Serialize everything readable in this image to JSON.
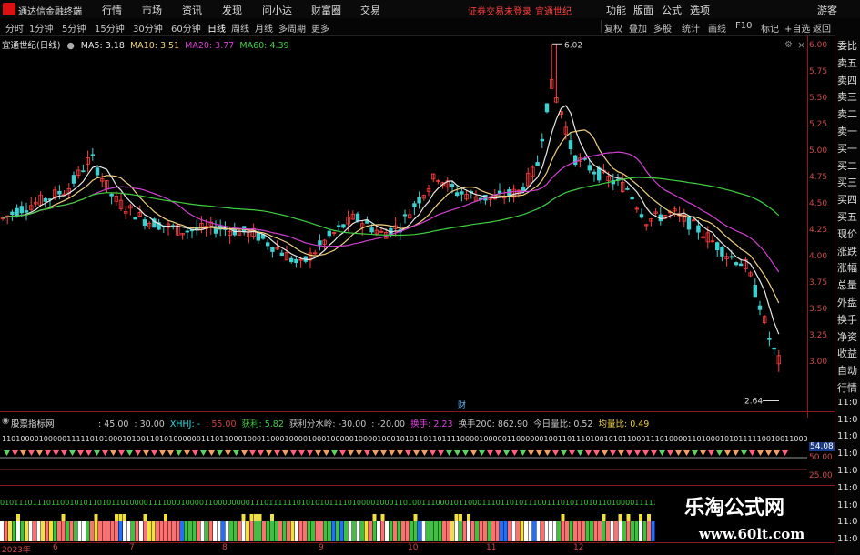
{
  "app": {
    "title": "通达信金融终端",
    "login_tip": "证券交易未登录",
    "stock_name": "宜通世纪"
  },
  "menu": [
    "行情",
    "市场",
    "资讯",
    "发现",
    "问小达",
    "财富圈",
    "交易"
  ],
  "top_right": [
    "功能",
    "版面",
    "公式",
    "选项",
    "游客"
  ],
  "periods": [
    {
      "label": "分时",
      "active": false
    },
    {
      "label": "1分钟",
      "active": false
    },
    {
      "label": "5分钟",
      "active": false
    },
    {
      "label": "15分钟",
      "active": false
    },
    {
      "label": "30分钟",
      "active": false
    },
    {
      "label": "60分钟",
      "active": false
    },
    {
      "label": "日线",
      "active": true
    },
    {
      "label": "周线",
      "active": false
    },
    {
      "label": "月线",
      "active": false
    },
    {
      "label": "多周期",
      "active": false
    },
    {
      "label": "更多",
      "active": false
    }
  ],
  "toolbar_right": [
    "复权",
    "叠加",
    "多股",
    "统计",
    "画线",
    "F10",
    "标记",
    "+自选",
    "返回"
  ],
  "chart": {
    "title": "宜通世纪(日线)",
    "ma": [
      {
        "label": "MA5: 3.18",
        "color": "#e8e8e8"
      },
      {
        "label": "MA10: 3.51",
        "color": "#f0d080"
      },
      {
        "label": "MA20: 3.77",
        "color": "#d040d0"
      },
      {
        "label": "MA60: 4.39",
        "color": "#40d040"
      }
    ],
    "high_label": "6.02",
    "low_label": "2.64",
    "y_ticks": [
      "6.00",
      "5.75",
      "5.50",
      "5.25",
      "5.00",
      "4.75",
      "4.50",
      "4.25",
      "4.00",
      "3.75",
      "3.50",
      "3.25",
      "3.00"
    ],
    "ylim": [
      2.55,
      6.1
    ],
    "marker": "财"
  },
  "indicator": {
    "name": "股票指标网",
    "items": [
      {
        "label": ": 45.00",
        "color": "#c8c8c8"
      },
      {
        "label": ": 30.00",
        "color": "#c8c8c8"
      },
      {
        "label": "XHHJ: -",
        "color": "#3dd"
      },
      {
        "label": ": 55.00",
        "color": "#d04040"
      },
      {
        "label": "获利: 5.82",
        "color": "#40d040"
      },
      {
        "label": "获利分水岭: -30.00",
        "color": "#c8c8c8"
      },
      {
        "label": ": -20.00",
        "color": "#c8c8c8"
      },
      {
        "label": "换手: 2.23",
        "color": "#e040e0"
      },
      {
        "label": "换手200: 862.90",
        "color": "#c8c8c8"
      },
      {
        "label": "今日量比: 0.52",
        "color": "#c8c8c8"
      },
      {
        "label": "均量比: 0.49",
        "color": "#f0d040"
      }
    ],
    "axis_labels": [
      "54.08",
      "50.00",
      "25.00"
    ]
  },
  "side_panel": [
    "委比",
    "卖五",
    "卖四",
    "卖三",
    "卖二",
    "卖一",
    "买一",
    "买二",
    "买三",
    "买四",
    "买五",
    "现价",
    "涨跌",
    "涨幅",
    "总量",
    "外盘",
    "换手",
    "净资",
    "收益",
    "自动",
    "行情",
    "11:0",
    "11:0",
    "11:0",
    "11:0",
    "11:0",
    "11:0",
    "11:0",
    "11:0",
    "11:0"
  ],
  "months": [
    "2023年",
    "6",
    "7",
    "8",
    "9",
    "10",
    "11",
    "12"
  ],
  "watermark": {
    "line1": "乐淘公式网",
    "line2": "www.60lt.com"
  },
  "colors": {
    "up": "#ff3c3c",
    "down": "#3cd0d0",
    "axis": "#d14848"
  }
}
